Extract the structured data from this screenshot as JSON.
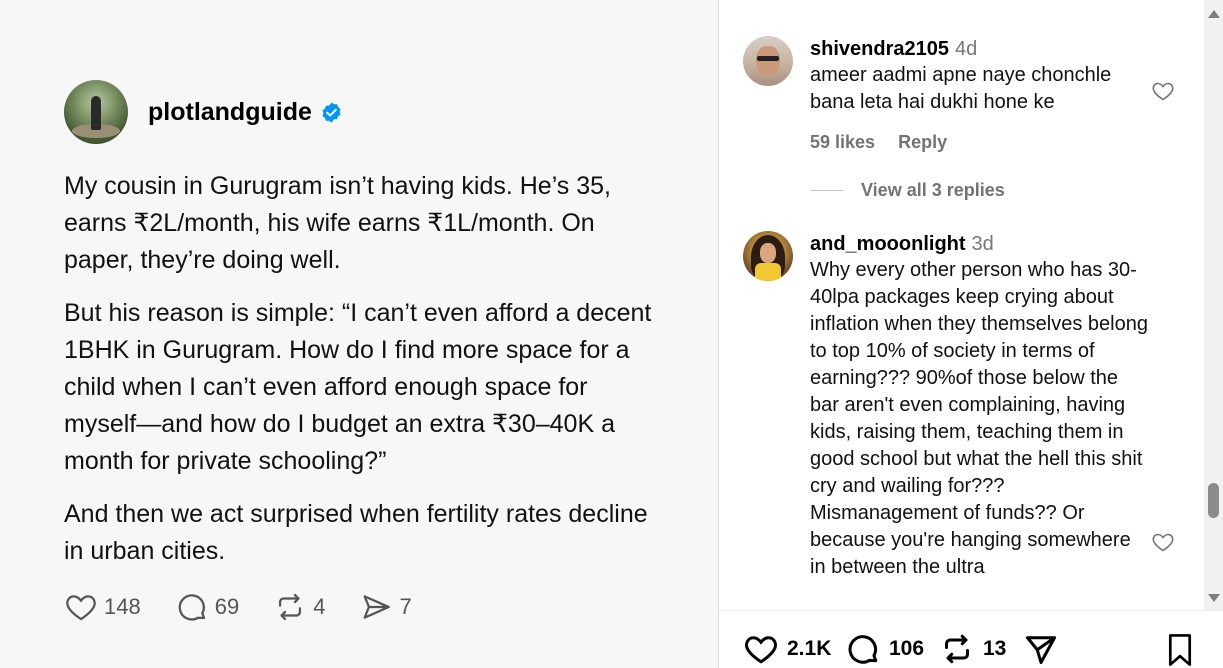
{
  "post": {
    "username": "plotlandguide",
    "paragraphs": [
      "My cousin in Gurugram isn’t having kids. He’s 35, earns ₹2L/month, his wife earns ₹1L/month. On paper, they’re doing well.",
      "But his reason is simple: “I can’t even afford a decent 1BHK in Gurugram. How do I find more space for a child when I can’t even afford enough space for myself—and how do I budget an extra ₹30–40K a month for private schooling?”",
      "And then we act surprised when fertility rates decline in urban cities."
    ],
    "actions": {
      "likes": "148",
      "comments": "69",
      "reposts": "4",
      "shares": "7"
    }
  },
  "comments": [
    {
      "username": "shivendra2105",
      "time": "4d",
      "text": "ameer aadmi apne naye chonchle bana leta hai dukhi hone ke",
      "likes_label": "59 likes",
      "reply_label": "Reply",
      "view_replies": "View all 3 replies"
    },
    {
      "username": "and_mooonlight",
      "time": "3d",
      "text": "Why every other person who has 30-40lpa packages keep crying about inflation when they themselves belong to top 10% of society in terms of earning??? 90%of those below the bar aren't even complaining, having kids, raising them, teaching them in good school but what the hell this shit cry and wailing for??? Mismanagement of funds?? Or because you're hanging somewhere in between the ultra"
    }
  ],
  "bottom_bar": {
    "likes": "2.1K",
    "comments": "106",
    "reposts": "13"
  },
  "icons": {
    "verified": "verified-badge-icon",
    "heart": "heart-icon",
    "comment": "comment-bubble-icon",
    "repost": "repost-icon",
    "share": "paper-plane-icon",
    "bookmark": "bookmark-icon"
  },
  "colors": {
    "verified": "#0095f6",
    "post_bg": "#f7f7f7",
    "muted_text": "#737373"
  }
}
